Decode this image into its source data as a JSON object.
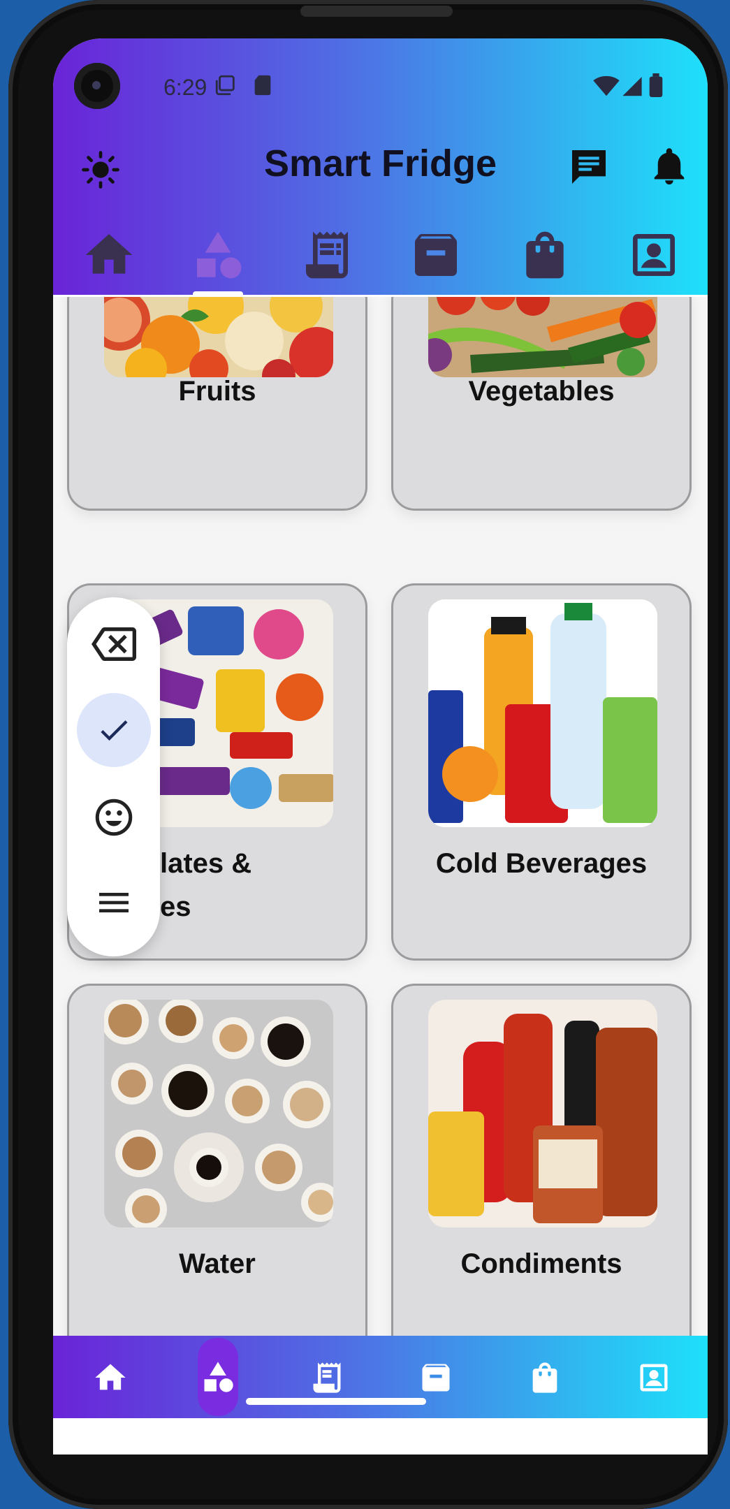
{
  "status_bar": {
    "time": "6:29"
  },
  "header": {
    "title": "Smart Fridge"
  },
  "categories": [
    {
      "label": "Fruits"
    },
    {
      "label": "Vegetables"
    },
    {
      "label_line1": "lates &",
      "label_line2": "es"
    },
    {
      "label": "Cold Beverages"
    },
    {
      "label": "Water"
    },
    {
      "label": "Condiments"
    }
  ],
  "colors": {
    "gradient_start": "#6a24d8",
    "gradient_end": "#1ee0fb",
    "active_tab": "#7a2de0",
    "card_bg": "#dcdcde"
  },
  "icons": {
    "top_left": "brightness-icon",
    "top_right": [
      "chat-icon",
      "bell-icon"
    ],
    "tabs": [
      "home-icon",
      "shapes-icon",
      "receipt-icon",
      "archive-icon",
      "shopping-bag-icon",
      "account-box-icon"
    ],
    "side_menu": [
      "backspace-icon",
      "check-icon",
      "smiley-icon",
      "menu-icon"
    ]
  }
}
